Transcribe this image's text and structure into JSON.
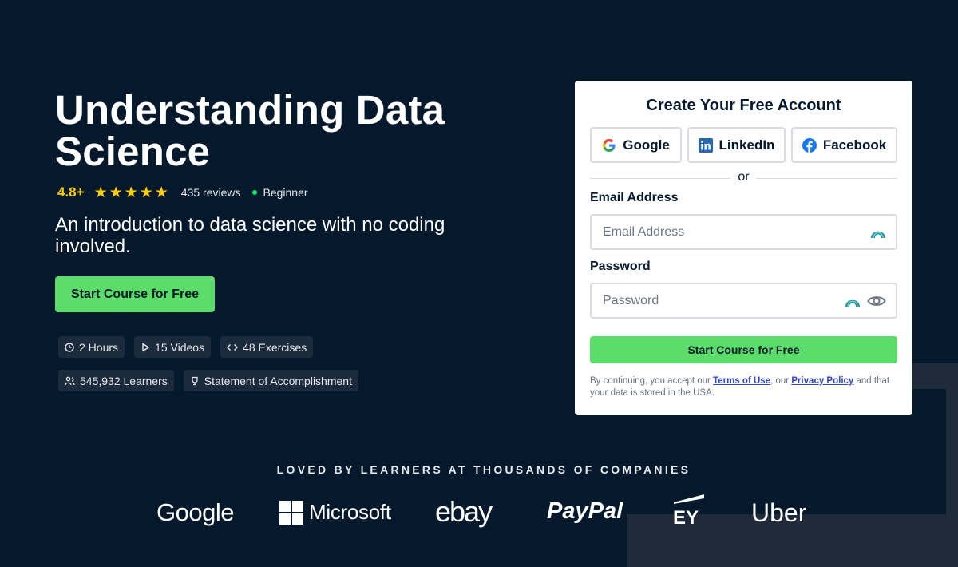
{
  "hero": {
    "title": "Understanding Data Science",
    "rating": "4.8+",
    "stars": 5,
    "reviews": "435 reviews",
    "level": "Beginner",
    "subtitle": "An introduction to data science with no coding involved.",
    "cta_label": "Start Course for Free",
    "chips": {
      "duration": "2 Hours",
      "videos": "15 Videos",
      "exercises": "48 Exercises",
      "learners": "545,932 Learners",
      "certificate": "Statement of Accomplishment"
    }
  },
  "signup": {
    "title": "Create Your Free Account",
    "google_label": "Google",
    "linkedin_label": "LinkedIn",
    "facebook_label": "Facebook",
    "or_text": "or",
    "email_label": "Email Address",
    "email_placeholder": "Email Address",
    "password_label": "Password",
    "password_placeholder": "Password",
    "submit_label": "Start Course for Free",
    "legal_prefix": "By continuing, you accept our ",
    "terms_link": "Terms of Use",
    "legal_mid": ", our ",
    "privacy_link": "Privacy Policy",
    "legal_suffix": " and that your data is stored in the USA."
  },
  "companies": {
    "title": "LOVED BY LEARNERS AT THOUSANDS OF COMPANIES",
    "logos": [
      "Google",
      "Microsoft",
      "ebay",
      "PayPal",
      "EY",
      "Uber"
    ]
  },
  "colors": {
    "background": "#05192d",
    "accent_green": "#5cdc6a",
    "star_yellow": "#fcce0d",
    "link_blue": "#3047c8"
  }
}
